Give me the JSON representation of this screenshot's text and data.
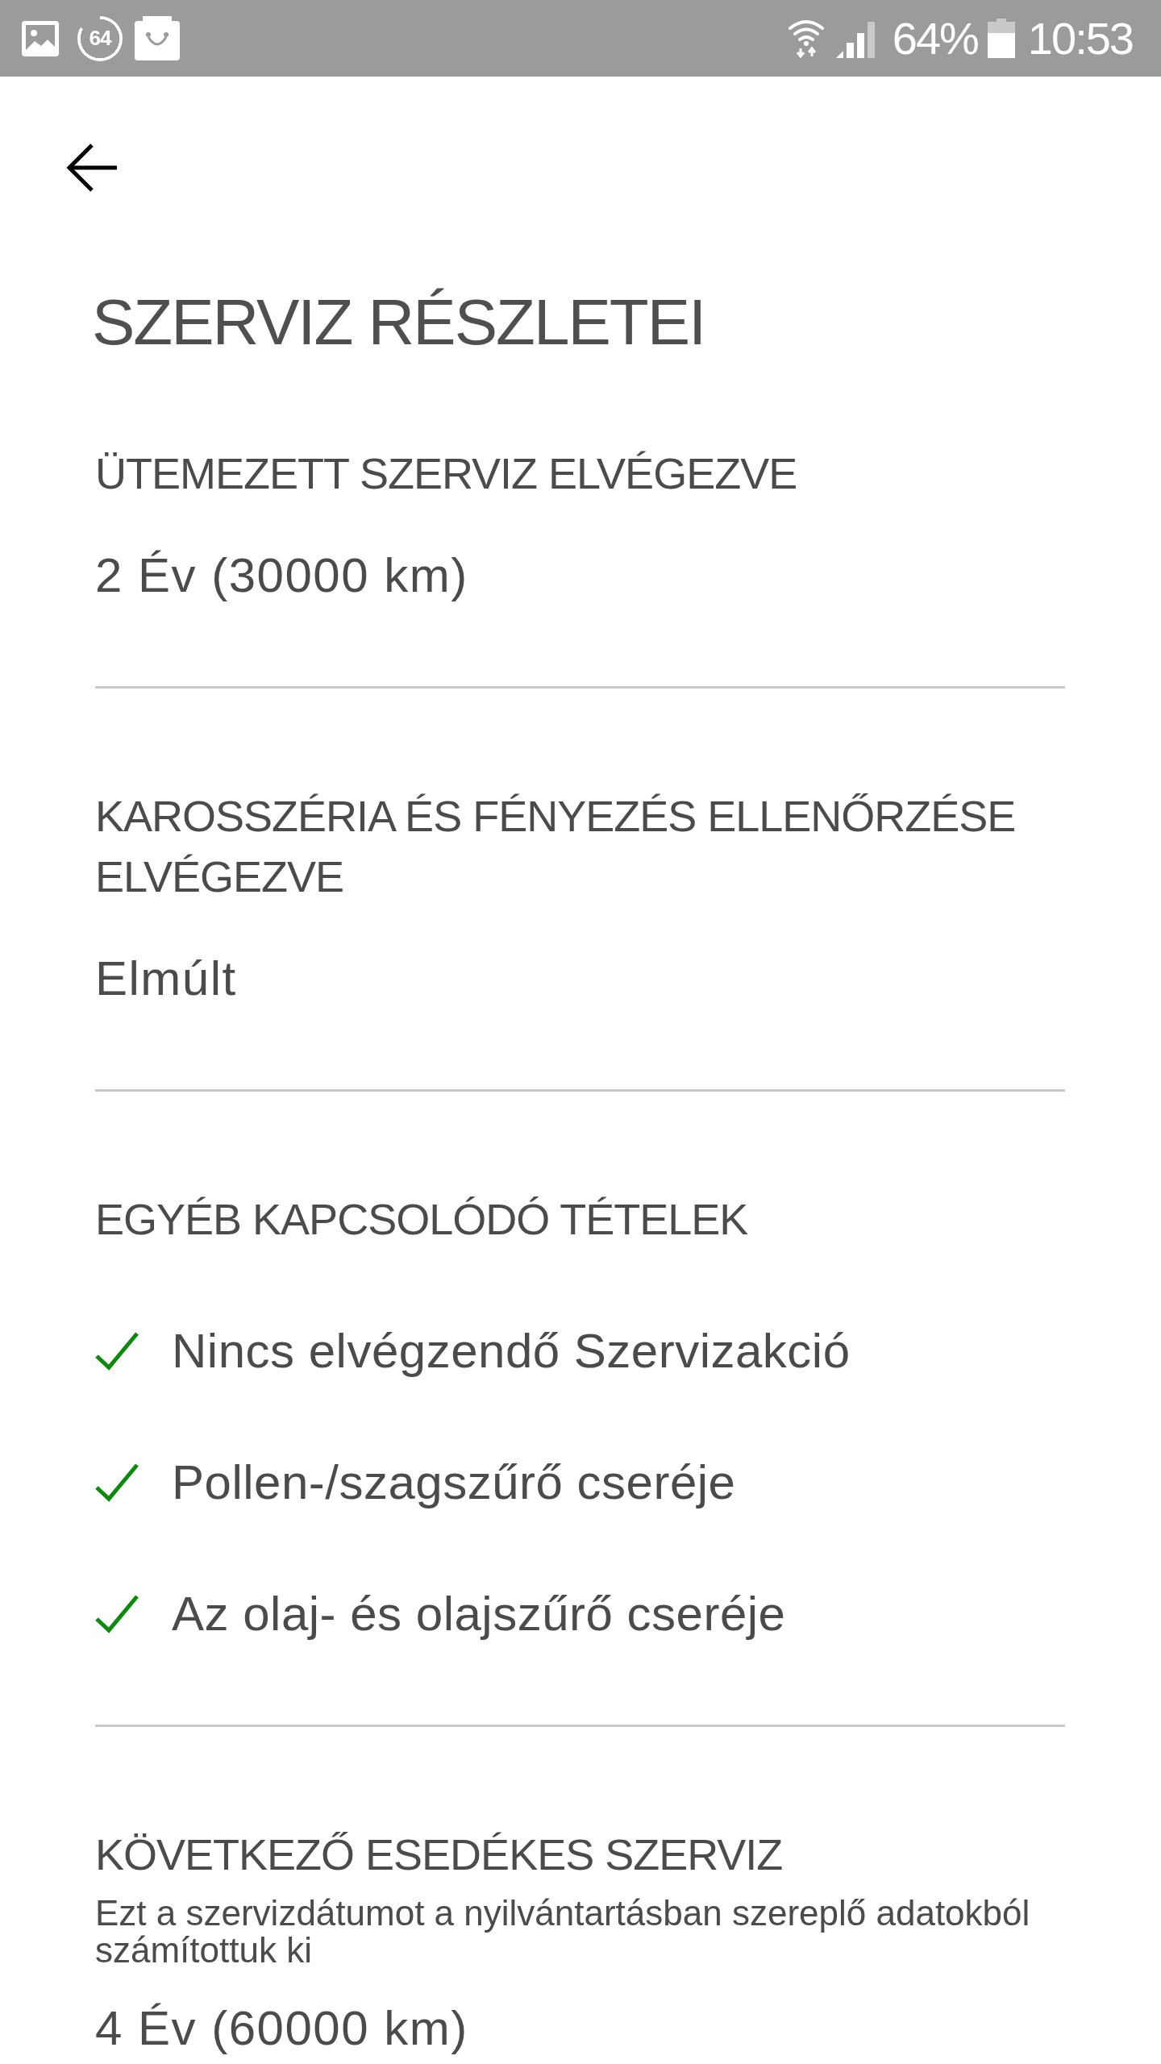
{
  "status_bar": {
    "notification_count": "64",
    "battery_percent": "64%",
    "time": "10:53"
  },
  "header": {
    "title": "SZERVIZ RÉSZLETEI"
  },
  "sections": [
    {
      "kind": "value",
      "heading": "ÜTEMEZETT SZERVIZ ELVÉGEZVE",
      "value": "2 Év (30000 km)"
    },
    {
      "kind": "value",
      "heading": "KAROSSZÉRIA ÉS FÉNYEZÉS ELLENŐRZÉSE ELVÉGEZVE",
      "value": "Elmúlt"
    },
    {
      "kind": "checklist",
      "heading": "EGYÉB KAPCSOLÓDÓ TÉTELEK",
      "items": [
        {
          "label": "Nincs elvégzendő Szervizakció",
          "checked": true
        },
        {
          "label": "Pollen-/szagszűrő cseréje",
          "checked": true
        },
        {
          "label": "Az olaj- és olajszűrő cseréje",
          "checked": true
        }
      ]
    },
    {
      "kind": "value",
      "heading": "KÖVETKEZŐ ESEDÉKES SZERVIZ",
      "note": "Ezt a szervizdátumot a nyilvántartásban szereplő adatokból számítottuk ki",
      "value": "4 Év (60000 km)"
    }
  ]
}
